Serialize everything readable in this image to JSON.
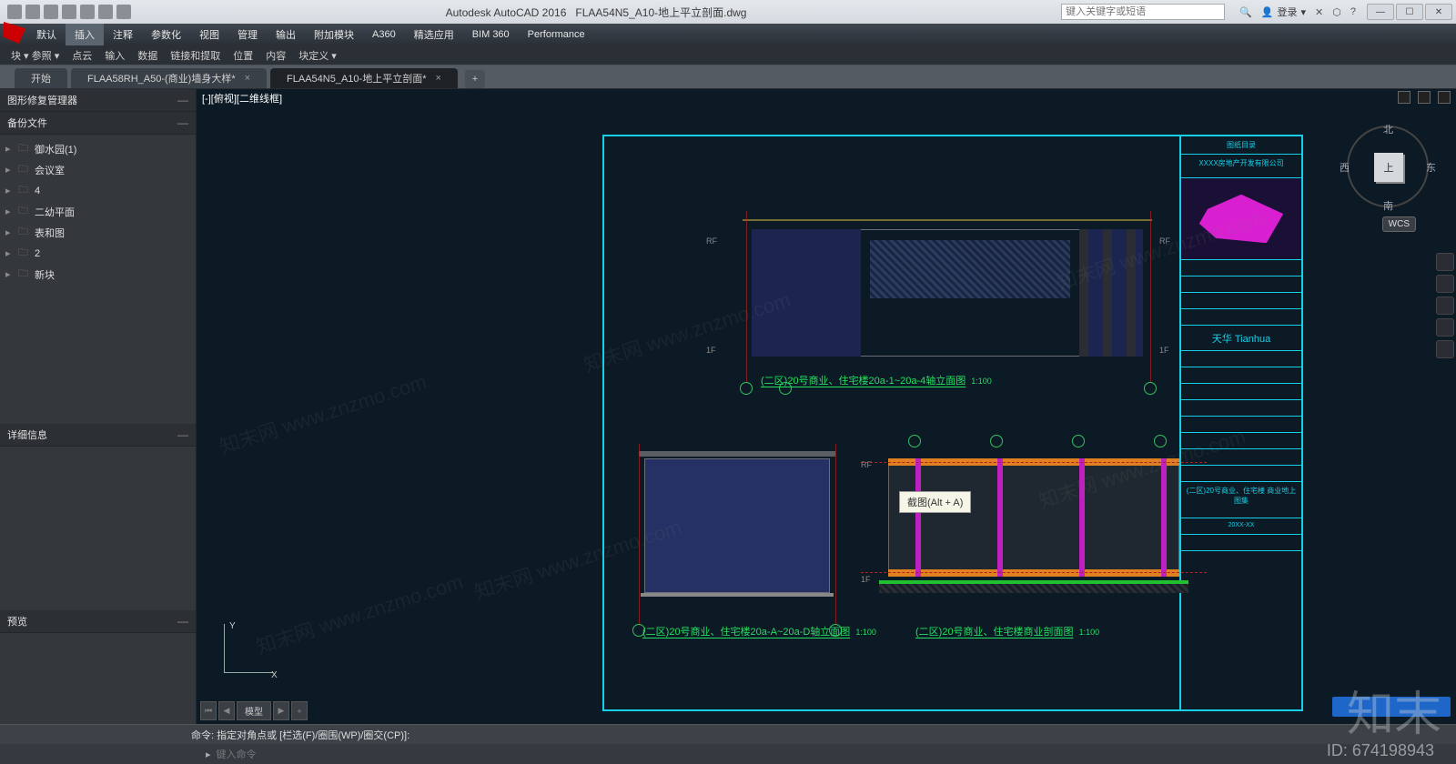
{
  "titlebar": {
    "app": "Autodesk AutoCAD 2016",
    "doc": "FLAA54N5_A10-地上平立剖面.dwg",
    "search_placeholder": "键入关键字或短语",
    "login": "登录",
    "win_min": "—",
    "win_max": "☐",
    "win_close": "✕"
  },
  "menu": {
    "items": [
      "默认",
      "插入",
      "注释",
      "参数化",
      "视图",
      "管理",
      "输出",
      "附加模块",
      "A360",
      "精选应用",
      "BIM 360",
      "Performance"
    ],
    "active_index": 1
  },
  "submenu": {
    "prefix": "块 ▾ 参照 ▾",
    "items": [
      "点云",
      "输入",
      "数据",
      "链接和提取",
      "位置",
      "内容",
      "块定义 ▾"
    ]
  },
  "tabs": {
    "items": [
      {
        "label": "开始",
        "dirty": false
      },
      {
        "label": "FLAA58RH_A50-(商业)墙身大样*",
        "dirty": true
      },
      {
        "label": "FLAA54N5_A10-地上平立剖面*",
        "dirty": true
      }
    ],
    "active_index": 2,
    "add": "+"
  },
  "sidebar": {
    "panel1_title": "图形修复管理器",
    "panel2_title": "备份文件",
    "tree": [
      {
        "label": "御水园(1)"
      },
      {
        "label": "会议室"
      },
      {
        "label": "4"
      },
      {
        "label": "二幼平面"
      },
      {
        "label": "表和图"
      },
      {
        "label": "2"
      },
      {
        "label": "新块"
      }
    ],
    "panel3_title": "详细信息",
    "panel4_title": "预览"
  },
  "viewtabs": "[-][俯视][二维线框]",
  "viewcube": {
    "face": "上",
    "n": "北",
    "s": "南",
    "e": "东",
    "w": "西"
  },
  "wcs": "WCS",
  "drawings": {
    "caption1": "(二区)20号商业、住宅楼20a-1~20a-4轴立面图",
    "caption2": "(二区)20号商业、住宅楼20a-A~20a-D轴立面图",
    "caption3": "(二区)20号商业、住宅楼商业剖面图",
    "scale": "1:100",
    "level_rf": "RF",
    "level_1f": "1F"
  },
  "titleblock": {
    "header": "图纸目录",
    "company": "XXXX房地产开发有限公司",
    "brand": "天华 Tianhua",
    "sheet": "(二区)20号商业、住宅楼 商业地上图集",
    "date": "20XX-XX"
  },
  "tooltip": "截图(Alt + A)",
  "ucs": {
    "x": "X",
    "y": "Y"
  },
  "layout": {
    "nav_first": "⏮",
    "nav_prev": "◀",
    "tab": "模型",
    "nav_next": "▶",
    "add": "+"
  },
  "cmd": {
    "text": "命令: 指定对角点或 [栏选(F)/圈围(WP)/圈交(CP)]:",
    "prompt_icon": "▸",
    "prompt_hint": "键入命令"
  },
  "watermarks": {
    "wm": "知末网 www.znzmo.com",
    "brand": "知末",
    "id": "ID: 674198943"
  }
}
